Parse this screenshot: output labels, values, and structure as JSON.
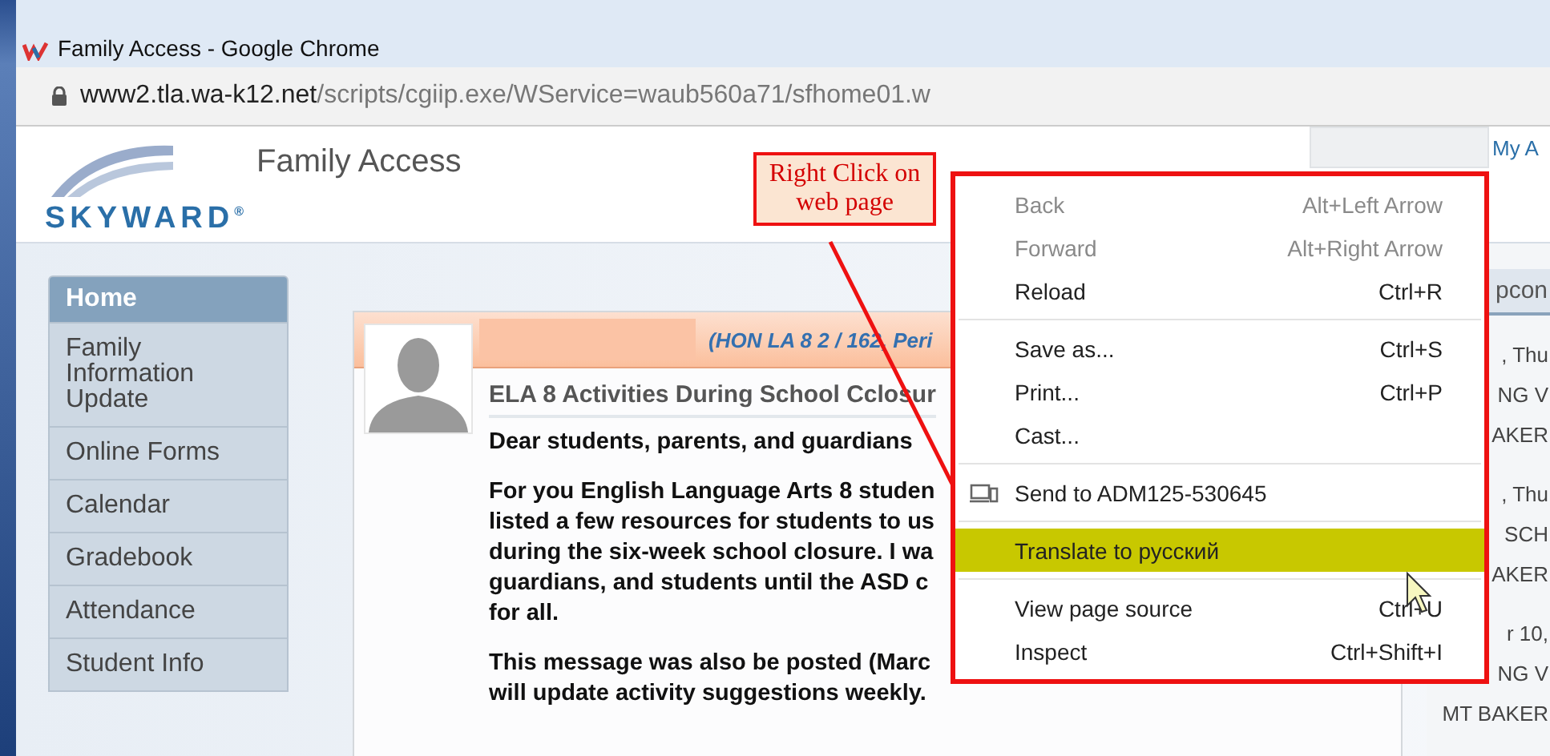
{
  "window": {
    "title": "Family Access - Google Chrome"
  },
  "address_bar": {
    "host": "www2.tla.wa-k12.net",
    "path": "/scripts/cgiip.exe/WService=waub560a71/sfhome01.w"
  },
  "header": {
    "logo_text": "SKYWARD",
    "logo_mark": "®",
    "title": "Family Access",
    "link": "My A"
  },
  "sidebar": {
    "items": [
      {
        "label": "Home",
        "selected": true
      },
      {
        "label": "Family Information Update",
        "selected": false
      },
      {
        "label": "Online Forms",
        "selected": false
      },
      {
        "label": "Calendar",
        "selected": false
      },
      {
        "label": "Gradebook",
        "selected": false
      },
      {
        "label": "Attendance",
        "selected": false
      },
      {
        "label": "Student Info",
        "selected": false
      }
    ]
  },
  "message": {
    "course": "(HON LA 8 2 / 162, Peri",
    "title": "ELA 8 Activities During School Cclosur",
    "paragraphs": [
      [
        "Dear students, parents, and guardians"
      ],
      [
        "For you English Language Arts 8 studen",
        "listed a few resources for students to us",
        "during the six-week school closure. I wa",
        "guardians, and students until the ASD c",
        "for all."
      ],
      [
        "This message was also be posted (Marc",
        "will update activity suggestions weekly."
      ]
    ]
  },
  "right_panel": {
    "tab": "pcon",
    "entries": [
      ", Thu",
      "NG V",
      "AKER",
      ", Thu",
      "SCH",
      "AKER",
      "r 10,",
      "NG V",
      "MT BAKER"
    ]
  },
  "callout": {
    "text": "Right Click on web page"
  },
  "context_menu": {
    "groups": [
      [
        {
          "label": "Back",
          "shortcut": "Alt+Left Arrow",
          "disabled": true,
          "selected": false
        },
        {
          "label": "Forward",
          "shortcut": "Alt+Right Arrow",
          "disabled": true,
          "selected": false
        },
        {
          "label": "Reload",
          "shortcut": "Ctrl+R",
          "disabled": false,
          "selected": false
        }
      ],
      [
        {
          "label": "Save as...",
          "shortcut": "Ctrl+S",
          "disabled": false,
          "selected": false
        },
        {
          "label": "Print...",
          "shortcut": "Ctrl+P",
          "disabled": false,
          "selected": false
        },
        {
          "label": "Cast...",
          "disabled": false,
          "selected": false
        }
      ],
      [
        {
          "label": "Send to ADM125-530645",
          "kind": "device",
          "disabled": false,
          "selected": false
        }
      ],
      [
        {
          "label": "Translate to русский",
          "disabled": false,
          "selected": true
        }
      ],
      [
        {
          "label": "View page source",
          "shortcut": "Ctrl+U",
          "disabled": false,
          "selected": false
        },
        {
          "label": "Inspect",
          "shortcut": "Ctrl+Shift+I",
          "disabled": false,
          "selected": false
        }
      ]
    ]
  }
}
